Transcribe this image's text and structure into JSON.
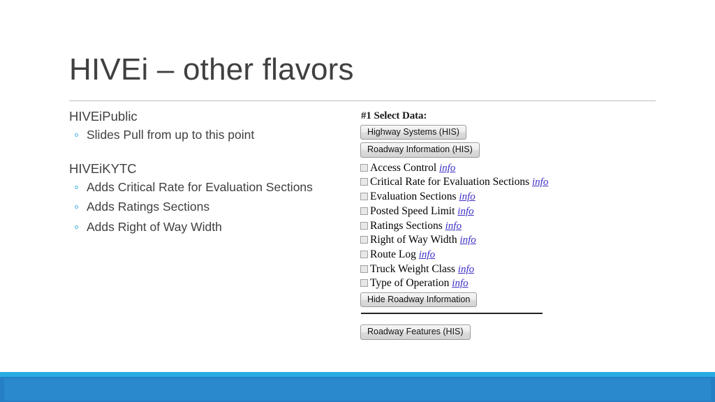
{
  "slide": {
    "title": "HIVEi – other flavors",
    "accent_cyan": "#29abe2",
    "accent_blue": "#2480c2",
    "title_color": "#404040"
  },
  "left_content": {
    "groups": [
      {
        "heading": "HIVEiPublic",
        "bullets": [
          "Slides Pull from up to this point"
        ]
      },
      {
        "heading": "HIVEiKYTC",
        "bullets": [
          "Adds Critical Rate for Evaluation Sections",
          "Adds Ratings Sections",
          "Adds Right of Way Width"
        ]
      }
    ]
  },
  "form_panel": {
    "heading": "#1 Select Data:",
    "top_buttons": [
      "Highway Systems (HIS)",
      "Roadway Information (HIS)"
    ],
    "checkboxes": [
      {
        "label": "Access Control",
        "info": "info",
        "checked": false
      },
      {
        "label": "Critical Rate for Evaluation Sections",
        "info": "info",
        "checked": false
      },
      {
        "label": "Evaluation Sections",
        "info": "info",
        "checked": false
      },
      {
        "label": "Posted Speed Limit",
        "info": "info",
        "checked": false
      },
      {
        "label": "Ratings Sections",
        "info": "info",
        "checked": false
      },
      {
        "label": "Right of Way Width",
        "info": "info",
        "checked": false
      },
      {
        "label": "Route Log",
        "info": "info",
        "checked": false
      },
      {
        "label": "Truck Weight Class",
        "info": "info",
        "checked": false
      },
      {
        "label": "Type of Operation",
        "info": "info",
        "checked": false
      }
    ],
    "hide_button": "Hide Roadway Information",
    "features_button": "Roadway Features (HIS)",
    "link_color": "#3b2ec4"
  }
}
